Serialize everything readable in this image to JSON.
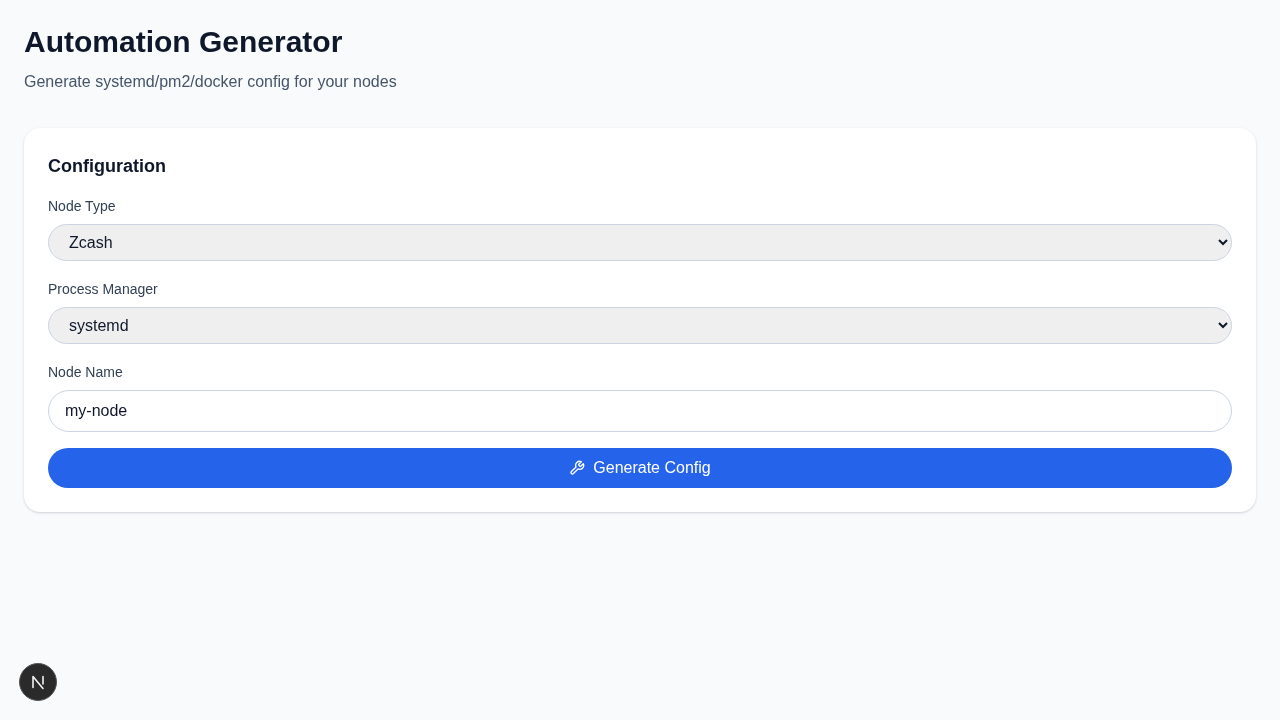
{
  "page": {
    "title": "Automation Generator",
    "subtitle": "Generate systemd/pm2/docker config for your nodes"
  },
  "configuration": {
    "title": "Configuration",
    "fields": [
      {
        "kind": "select",
        "label": "Node Type",
        "value": "Zcash"
      },
      {
        "kind": "select",
        "label": "Process Manager",
        "value": "systemd"
      },
      {
        "kind": "text",
        "label": "Node Name",
        "value": "my-node"
      }
    ],
    "button": {
      "label": "Generate Config"
    }
  }
}
